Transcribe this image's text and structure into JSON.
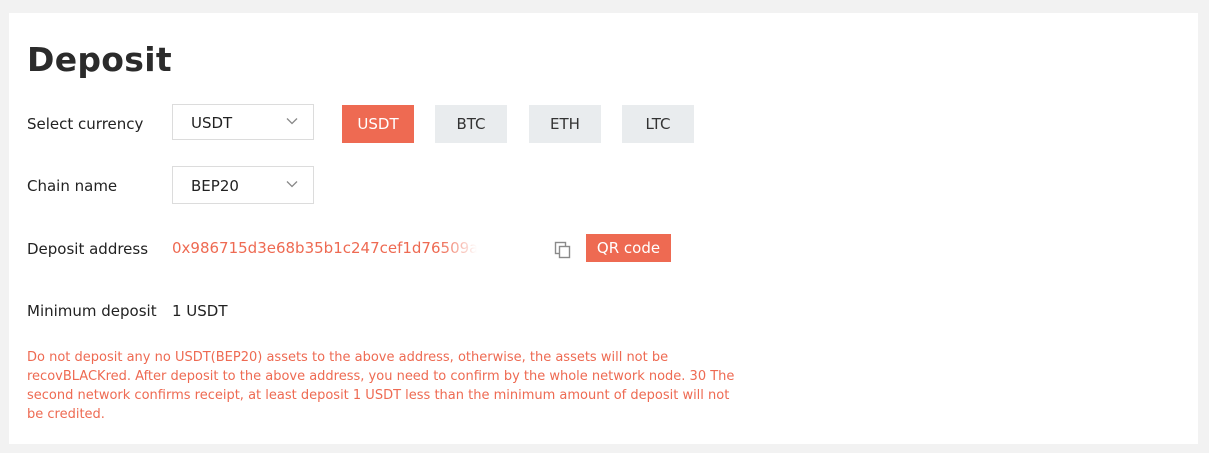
{
  "page": {
    "title": "Deposit"
  },
  "currency": {
    "label": "Select currency",
    "selected": "USDT",
    "options": [
      {
        "label": "USDT",
        "active": true
      },
      {
        "label": "BTC",
        "active": false
      },
      {
        "label": "ETH",
        "active": false
      },
      {
        "label": "LTC",
        "active": false
      }
    ]
  },
  "chain": {
    "label": "Chain name",
    "selected": "BEP20"
  },
  "deposit_address": {
    "label": "Deposit address",
    "value": "0x986715d3e68b35b1c247cef1d76509a",
    "copy_icon": "copy-icon",
    "qr_button": "QR code"
  },
  "minimum": {
    "label": "Minimum deposit",
    "value": "1 USDT"
  },
  "notice": "Do not deposit any no USDT(BEP20) assets to the above address, otherwise, the assets will not be recovBLACKred. After deposit to the above address, you need to confirm by the whole network node. 30 The second network confirms receipt, at least deposit 1 USDT less than the minimum amount of deposit will not be credited.",
  "colors": {
    "accent": "#ee6a52",
    "pill_inactive": "#e9ecee",
    "page_bg": "#f2f2f2"
  }
}
